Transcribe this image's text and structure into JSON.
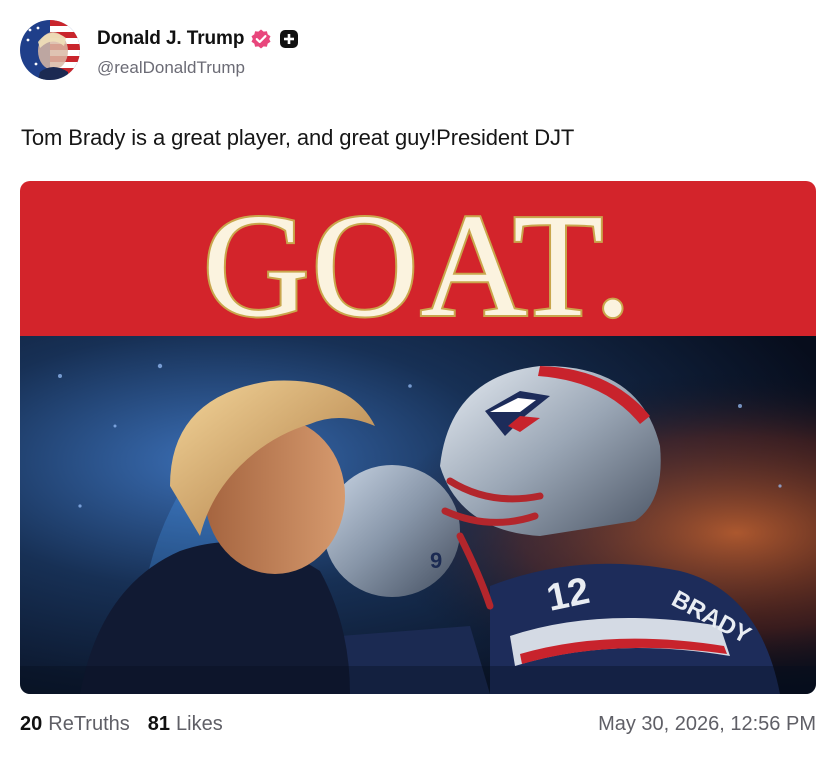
{
  "post": {
    "author": {
      "display_name": "Donald J. Trump",
      "handle": "@realDonaldTrump",
      "avatar_icon": "flag-portrait-avatar",
      "verified_badge_icon": "verified-badge-icon",
      "verified_badge_color": "#e8467c",
      "plus_badge_icon": "plus-badge-icon"
    },
    "text": "Tom Brady is a great player, and great guy!President DJT",
    "media": {
      "headline": "GOAT.",
      "banner_color": "#d3242b",
      "headline_color": "#fbf3df",
      "headline_outline_color": "#c9a64c"
    },
    "stats": {
      "retruths_count": "20",
      "retruths_label": "ReTruths",
      "likes_count": "81",
      "likes_label": "Likes"
    },
    "timestamp": "May 30, 2026, 12:56 PM"
  }
}
